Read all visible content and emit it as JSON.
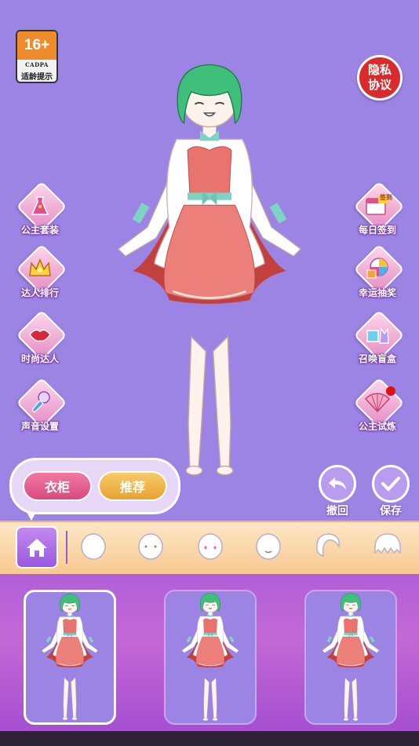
{
  "age_rating": {
    "badge": "16+",
    "org": "CADPA",
    "note": "适龄提示"
  },
  "privacy": {
    "label": "隐私协议"
  },
  "left_menu": [
    {
      "label": "公主套装",
      "icon": "dress-icon"
    },
    {
      "label": "达人排行",
      "icon": "crown-ranking-icon"
    },
    {
      "label": "时尚达人",
      "icon": "lips-icon"
    },
    {
      "label": "声音设置",
      "icon": "microphone-icon"
    }
  ],
  "right_menu": [
    {
      "label": "每日签到",
      "icon": "calendar-signin-icon",
      "badge_text": "签到"
    },
    {
      "label": "幸运抽奖",
      "icon": "lucky-wheel-icon"
    },
    {
      "label": "召唤盲盒",
      "icon": "blind-box-icon"
    },
    {
      "label": "公主试炼",
      "icon": "fan-icon",
      "has_red_dot": true
    }
  ],
  "mode_tabs": {
    "wardrobe": "衣柜",
    "recommend": "推荐",
    "active": "衣柜"
  },
  "actions": {
    "undo": "撤回",
    "save": "保存"
  },
  "categories": [
    "home-icon",
    "face-shape-icon",
    "face-expression-icon",
    "blush-face-icon",
    "smile-face-icon",
    "hair-back-icon",
    "hair-front-icon"
  ],
  "outfit_cards": [
    {
      "name": "outfit-1",
      "selected": true
    },
    {
      "name": "outfit-2",
      "selected": false
    },
    {
      "name": "outfit-3",
      "selected": false
    }
  ],
  "colors": {
    "background": "#9b84e3",
    "hair": "#3fbf7a",
    "dress": "#e8736f",
    "accent_pink": "#e0559a",
    "panel": "#b15fd8"
  }
}
